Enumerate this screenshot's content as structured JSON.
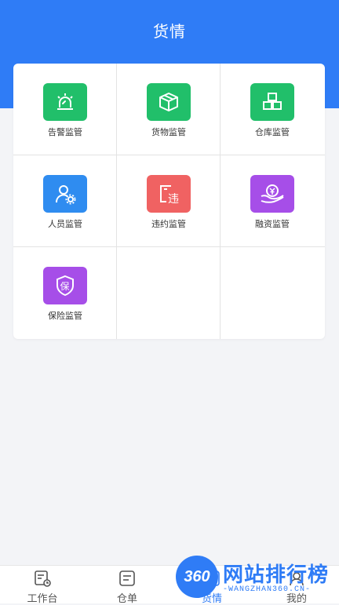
{
  "header": {
    "title": "货情"
  },
  "grid": {
    "items": [
      {
        "label": "告警监管",
        "icon": "alarm-icon",
        "color": "#21bf6a"
      },
      {
        "label": "货物监管",
        "icon": "package-icon",
        "color": "#21bf6a"
      },
      {
        "label": "仓库监管",
        "icon": "boxes-icon",
        "color": "#21bf6a"
      },
      {
        "label": "人员监管",
        "icon": "user-gear-icon",
        "color": "#2f8cf0"
      },
      {
        "label": "违约监管",
        "icon": "breach-icon",
        "color": "#f06262"
      },
      {
        "label": "融资监管",
        "icon": "yen-hand-icon",
        "color": "#a64ee8"
      },
      {
        "label": "保险监管",
        "icon": "shield-bao-icon",
        "color": "#a64ee8",
        "icon_text": "保"
      }
    ],
    "breach_icon_text": "违"
  },
  "tabbar": {
    "items": [
      {
        "label": "工作台",
        "icon": "workbench-icon"
      },
      {
        "label": "仓单",
        "icon": "receipt-icon"
      },
      {
        "label": "货情",
        "icon": "goods-icon",
        "active": true
      },
      {
        "label": "我的",
        "icon": "profile-icon"
      }
    ]
  },
  "watermark": {
    "logo_text": "360",
    "title": "网站排行榜",
    "subtitle": "-WANGZHAN360.CN-"
  },
  "colors": {
    "primary": "#2f7cf6",
    "green": "#21bf6a",
    "red": "#f06262",
    "purple": "#a64ee8"
  }
}
